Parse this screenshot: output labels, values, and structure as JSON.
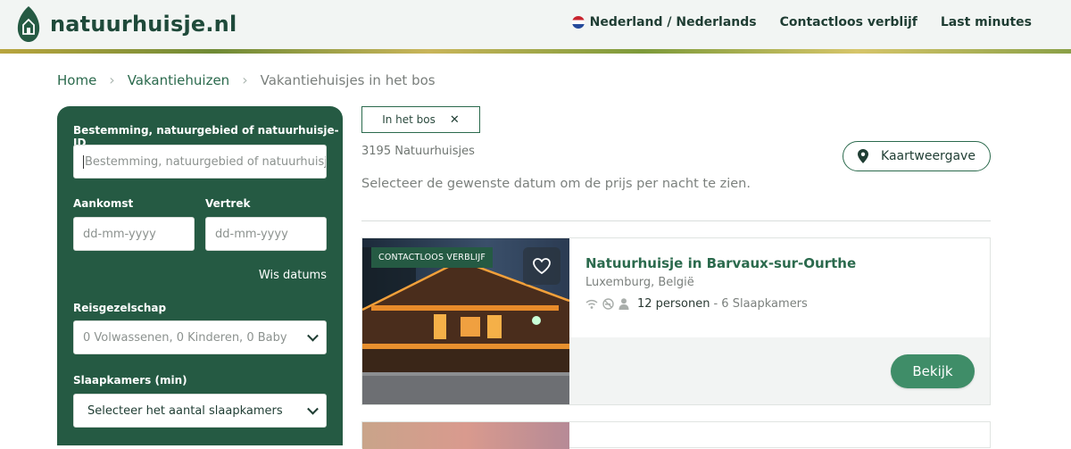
{
  "header": {
    "logo_text": "natuurhuisje.nl",
    "nav": [
      {
        "label": "Nederland / Nederlands",
        "icon": "flag-nl-icon"
      },
      {
        "label": "Contactloos verblijf"
      },
      {
        "label": "Last minutes"
      }
    ]
  },
  "breadcrumb": {
    "items": [
      "Home",
      "Vakantiehuizen"
    ],
    "current": "Vakantiehuisjes in het bos",
    "separator": "›"
  },
  "filter": {
    "destination_label": "Bestemming, natuurgebied of natuurhuisje-ID",
    "destination_placeholder": "Bestemming, natuurgebied of natuurhuisje-",
    "arrival_label": "Aankomst",
    "arrival_placeholder": "dd-mm-yyyy",
    "departure_label": "Vertrek",
    "departure_placeholder": "dd-mm-yyyy",
    "clear_dates": "Wis datums",
    "party_label": "Reisgezelschap",
    "party_value": "0 Volwassenen, 0 Kinderen, 0 Baby",
    "bedrooms_label": "Slaapkamers (min)",
    "bedrooms_value": "Selecteer het aantal slaapkamers"
  },
  "results": {
    "active_filter": "In het bos",
    "active_filter_remove": "✕",
    "count": "3195 Natuurhuisjes",
    "date_hint": "Selecteer de gewenste datum om de prijs per nacht te zien.",
    "map_button": "Kaartweergave"
  },
  "listing": {
    "badge": "CONTACTLOOS VERBLIJF",
    "title": "Natuurhuisje in Barvaux-sur-Ourthe",
    "location": "Luxemburg, België",
    "persons": "12 personen",
    "bedrooms": "- 6 Slaapkamers",
    "view_button": "Bekijk"
  },
  "colors": {
    "brand_green": "#255a43",
    "link_green": "#2b6a4d",
    "button_green": "#3f8d68"
  }
}
